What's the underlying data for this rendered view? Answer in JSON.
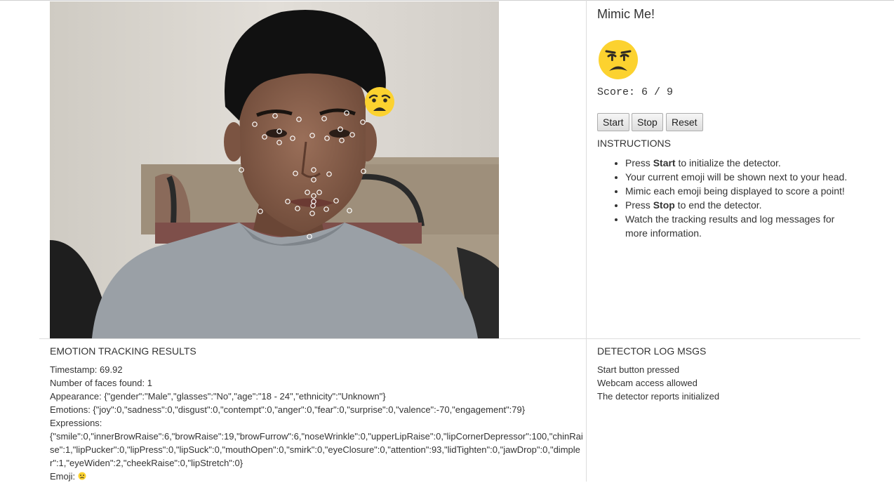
{
  "app": {
    "title": "Mimic Me!",
    "score_label": "Score:",
    "score_value": "6 / 9",
    "target_emoji": "weary-face-icon"
  },
  "controls": {
    "start_label": "Start",
    "stop_label": "Stop",
    "reset_label": "Reset"
  },
  "instructions": {
    "heading": "INSTRUCTIONS",
    "items": [
      {
        "pre": "Press ",
        "bold": "Start",
        "post": " to initialize the detector."
      },
      {
        "pre": "Your current emoji will be shown next to your head.",
        "bold": "",
        "post": ""
      },
      {
        "pre": "Mimic each emoji being displayed to score a point!",
        "bold": "",
        "post": ""
      },
      {
        "pre": "Press ",
        "bold": "Stop",
        "post": " to end the detector."
      },
      {
        "pre": "Watch the tracking results and log messages for more information.",
        "bold": "",
        "post": ""
      }
    ]
  },
  "results": {
    "heading": "EMOTION TRACKING RESULTS",
    "timestamp": "Timestamp: 69.92",
    "faces": "Number of faces found: 1",
    "appearance": "Appearance: {\"gender\":\"Male\",\"glasses\":\"No\",\"age\":\"18 - 24\",\"ethnicity\":\"Unknown\"}",
    "emotions": "Emotions: {\"joy\":0,\"sadness\":0,\"disgust\":0,\"contempt\":0,\"anger\":0,\"fear\":0,\"surprise\":0,\"valence\":-70,\"engagement\":79}",
    "expressions_label": "Expressions:",
    "expressions": "{\"smile\":0,\"innerBrowRaise\":6,\"browRaise\":19,\"browFurrow\":6,\"noseWrinkle\":0,\"upperLipRaise\":0,\"lipCornerDepressor\":100,\"chinRaise\":1,\"lipPucker\":0,\"lipPress\":0,\"lipSuck\":0,\"mouthOpen\":0,\"smirk\":0,\"eyeClosure\":0,\"attention\":93,\"lidTighten\":0,\"jawDrop\":0,\"dimpler\":1,\"eyeWiden\":2,\"cheekRaise\":0,\"lipStretch\":0}",
    "emoji": "Emoji: "
  },
  "log": {
    "heading": "DETECTOR LOG MSGS",
    "messages": [
      "Start button pressed",
      "Webcam access allowed",
      "The detector reports initialized"
    ]
  },
  "colors": {
    "emoji_yellow": "#fcd22f",
    "emoji_dark": "#2e2a23",
    "text": "#333333",
    "divider": "#dddddd"
  }
}
